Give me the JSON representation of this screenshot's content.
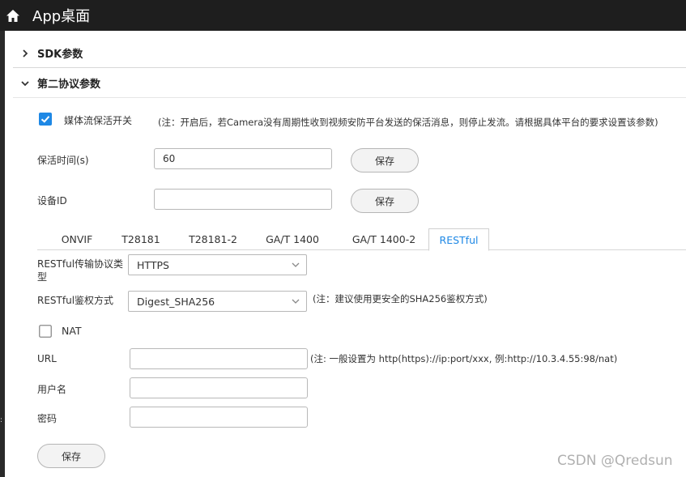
{
  "header": {
    "title": "App桌面"
  },
  "sections": {
    "sdk": "SDK参数",
    "second_protocol": "第二协议参数"
  },
  "keepalive": {
    "checkbox_label": "媒体流保活开关",
    "checked": true,
    "note": "(注：开启后，若Camera没有周期性收到视频安防平台发送的保活消息，则停止发流。请根据具体平台的要求设置该参数)"
  },
  "keepalive_time": {
    "label": "保活时间(s)",
    "value": "60",
    "save": "保存"
  },
  "device_id": {
    "label": "设备ID",
    "value": "",
    "save": "保存"
  },
  "tabs": [
    {
      "label": "ONVIF",
      "active": false
    },
    {
      "label": "T28181",
      "active": false
    },
    {
      "label": "T28181-2",
      "active": false
    },
    {
      "label": "GA/T 1400",
      "active": false
    },
    {
      "label": "GA/T 1400-2",
      "active": false
    },
    {
      "label": "RESTful",
      "active": true
    }
  ],
  "restful": {
    "transport_label_1": "RESTful传输协议类",
    "transport_label_2": "型",
    "transport_value": "HTTPS",
    "auth_label": "RESTful鉴权方式",
    "auth_value": "Digest_SHA256",
    "auth_note": "(注：建议使用更安全的SHA256鉴权方式)",
    "nat_label": "NAT",
    "nat_checked": false,
    "url_label": "URL",
    "url_value": "",
    "url_note": "(注: 一般设置为 http(https)://ip:port/xxx, 例:http://10.3.4.55:98/nat)",
    "username_label": "用户名",
    "username_value": "",
    "password_label": "密码",
    "password_value": "",
    "save": "保存"
  },
  "watermark": "CSDN @Qredsun",
  "colors": {
    "topbar": "#1e1e1e",
    "checkbox": "#1e88e5",
    "active_tab": "#1e88e5"
  }
}
